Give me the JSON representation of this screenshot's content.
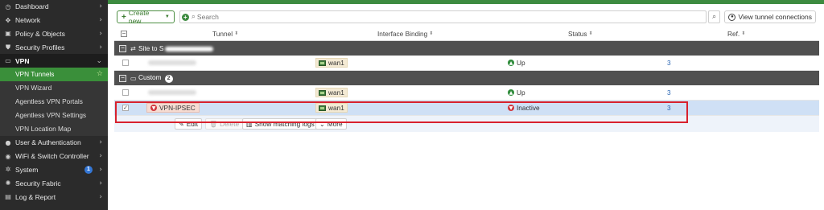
{
  "sidebar": {
    "items": [
      {
        "label": "Dashboard",
        "icon": "dashboard-icon",
        "glyph": "◷"
      },
      {
        "label": "Network",
        "icon": "network-icon",
        "glyph": "✥"
      },
      {
        "label": "Policy & Objects",
        "icon": "policy-icon",
        "glyph": "▣"
      },
      {
        "label": "Security Profiles",
        "icon": "shield-icon",
        "glyph": "⛊"
      },
      {
        "label": "VPN",
        "icon": "vpn-icon",
        "glyph": "▭"
      }
    ],
    "vpn_subitems": [
      {
        "label": "VPN Tunnels"
      },
      {
        "label": "VPN Wizard"
      },
      {
        "label": "Agentless VPN Portals"
      },
      {
        "label": "Agentless VPN Settings"
      },
      {
        "label": "VPN Location Map"
      }
    ],
    "items_after": [
      {
        "label": "User & Authentication",
        "icon": "user-icon",
        "glyph": "●"
      },
      {
        "label": "WiFi & Switch Controller",
        "icon": "wifi-icon",
        "glyph": "◉"
      },
      {
        "label": "System",
        "icon": "gear-icon",
        "glyph": "✲",
        "badge": "1"
      },
      {
        "label": "Security Fabric",
        "icon": "fabric-icon",
        "glyph": "✺"
      },
      {
        "label": "Log & Report",
        "icon": "chart-icon",
        "glyph": "▤"
      }
    ]
  },
  "toolbar": {
    "create_label": "Create new",
    "search_placeholder": "Search",
    "view_tunnel_label": "View tunnel connections"
  },
  "table": {
    "columns": [
      "Tunnel",
      "Interface Binding",
      "Status",
      "Ref."
    ],
    "groups": [
      {
        "title": "Site to S",
        "count": ""
      },
      {
        "title": "Custom",
        "count": "2"
      }
    ],
    "rows": [
      {
        "tunnel": "",
        "interface": "wan1",
        "status": "Up",
        "ref": "3"
      },
      {
        "tunnel": "",
        "interface": "wan1",
        "status": "Up",
        "ref": "3"
      },
      {
        "tunnel": "VPN-IPSEC",
        "interface": "wan1",
        "status": "Inactive",
        "ref": "3"
      }
    ]
  },
  "actions": {
    "edit": "Edit",
    "delete": "Delete",
    "logs": "Show matching logs",
    "more": "More"
  },
  "colors": {
    "accent": "#3d8b40",
    "sidebar_bg": "#2b2b2b",
    "selected_row": "#cfe0f5",
    "highlight": "#d8222e"
  }
}
